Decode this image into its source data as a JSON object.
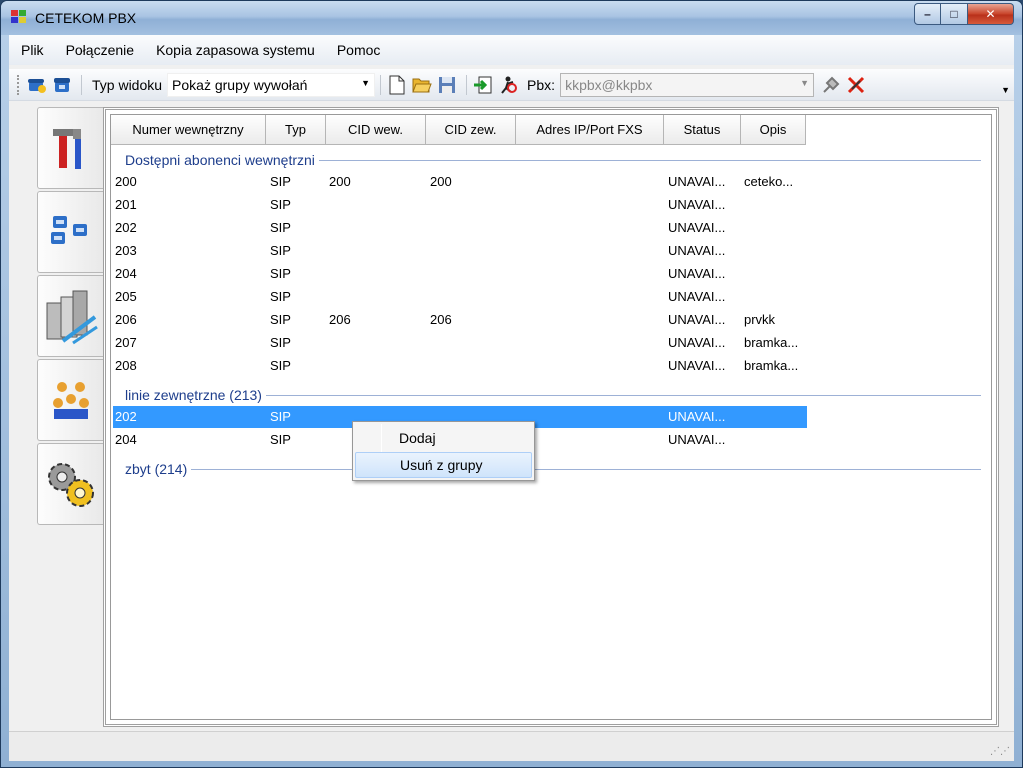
{
  "window": {
    "title": "CETEKOM PBX",
    "controls": {
      "minimize": "–",
      "maximize": "□",
      "close": "✕"
    }
  },
  "menu": [
    "Plik",
    "Połączenie",
    "Kopia zapasowa systemu",
    "Pomoc"
  ],
  "toolbar": {
    "view_type_label": "Typ widoku",
    "view_type_value": "Pokaż grupy wywołań",
    "pbx_label": "Pbx:",
    "pbx_value": "kkpbx@kkpbx"
  },
  "nav": {
    "icons": [
      "tools-icon",
      "phones-icon",
      "servers-icon",
      "users-group-icon",
      "gears-icon"
    ]
  },
  "table": {
    "columns": [
      "Numer wewnętrzny",
      "Typ",
      "CID wew.",
      "CID zew.",
      "Adres IP/Port FXS",
      "Status",
      "Opis"
    ],
    "groups": [
      {
        "name": "Dostępni abonenci wewnętrzni",
        "rows": [
          [
            "200",
            "SIP",
            "200",
            "200",
            "",
            "UNAVAI...",
            "ceteko..."
          ],
          [
            "201",
            "SIP",
            "",
            "",
            "",
            "UNAVAI...",
            ""
          ],
          [
            "202",
            "SIP",
            "",
            "",
            "",
            "UNAVAI...",
            ""
          ],
          [
            "203",
            "SIP",
            "",
            "",
            "",
            "UNAVAI...",
            ""
          ],
          [
            "204",
            "SIP",
            "",
            "",
            "",
            "UNAVAI...",
            ""
          ],
          [
            "205",
            "SIP",
            "",
            "",
            "",
            "UNAVAI...",
            ""
          ],
          [
            "206",
            "SIP",
            "206",
            "206",
            "",
            "UNAVAI...",
            "prvkk"
          ],
          [
            "207",
            "SIP",
            "",
            "",
            "",
            "UNAVAI...",
            "bramka..."
          ],
          [
            "208",
            "SIP",
            "",
            "",
            "",
            "UNAVAI...",
            "bramka..."
          ]
        ]
      },
      {
        "name": "linie zewnętrzne (213)",
        "rows": [
          [
            "202",
            "SIP",
            "",
            "",
            "",
            "UNAVAI...",
            ""
          ],
          [
            "204",
            "SIP",
            "",
            "",
            "",
            "UNAVAI...",
            ""
          ]
        ]
      },
      {
        "name": "zbyt (214)",
        "rows": []
      }
    ]
  },
  "context_menu": {
    "items": [
      "Dodaj",
      "Usuń z grupy"
    ]
  },
  "colors": {
    "selection": "#3399ff",
    "group_header": "#1e3e8c"
  }
}
